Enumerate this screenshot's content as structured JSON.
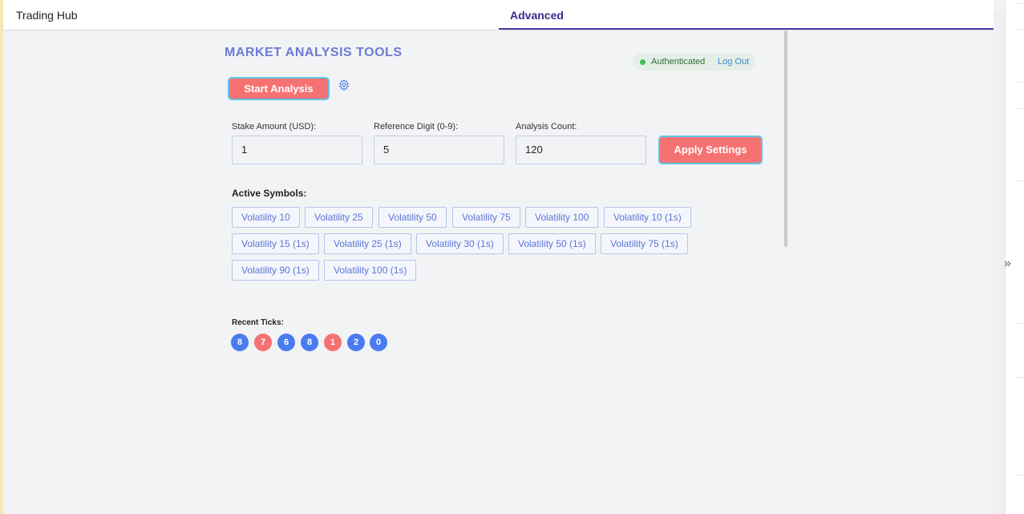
{
  "tabs": [
    {
      "label": "Trading Hub",
      "active": false
    },
    {
      "label": "Advanced",
      "active": true
    }
  ],
  "page": {
    "title": "MARKET ANALYSIS TOOLS",
    "auth_status": "Authenticated",
    "logout_label": "Log Out",
    "start_button": "Start Analysis",
    "apply_button": "Apply Settings"
  },
  "fields": {
    "stake": {
      "label": "Stake Amount (USD):",
      "value": "1"
    },
    "digit": {
      "label": "Reference Digit (0-9):",
      "value": "5"
    },
    "count": {
      "label": "Analysis Count:",
      "value": "120"
    }
  },
  "symbols": {
    "label": "Active Symbols:",
    "items": [
      "Volatility 10",
      "Volatility 25",
      "Volatility 50",
      "Volatility 75",
      "Volatility 100",
      "Volatility 10 (1s)",
      "Volatility 15 (1s)",
      "Volatility 25 (1s)",
      "Volatility 30 (1s)",
      "Volatility 50 (1s)",
      "Volatility 75 (1s)",
      "Volatility 90 (1s)",
      "Volatility 100 (1s)"
    ]
  },
  "ticks": {
    "label": "Recent Ticks:",
    "values": [
      "8",
      "7",
      "6",
      "8",
      "1",
      "2",
      "0"
    ],
    "colors": [
      "#4a7cf0",
      "#f67272",
      "#4a7cf0",
      "#4a7cf0",
      "#f67272",
      "#4a7cf0",
      "#4a7cf0"
    ]
  },
  "icons": {
    "settings": "gear-icon",
    "collapse": "double-chevron-right-icon"
  }
}
